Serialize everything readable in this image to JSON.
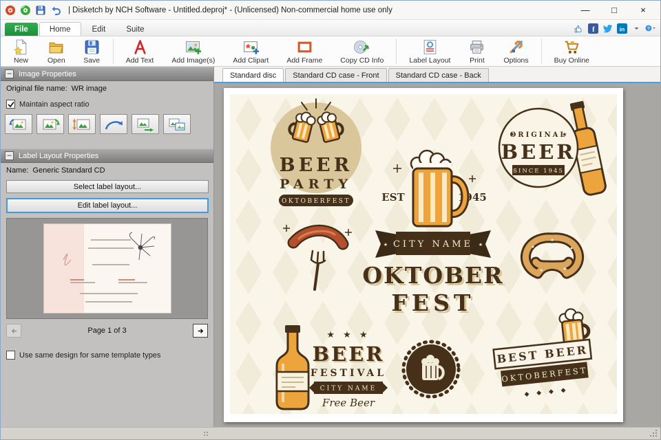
{
  "colors": {
    "accent_blue": "#45a0e6",
    "file_tab_green": "#1d8f3c",
    "poster_brown": "#463019",
    "poster_amber": "#eda43c",
    "poster_cream": "#f9f5e9"
  },
  "titlebar": {
    "title": "| Disketch by NCH Software - Untitled.deproj* - (Unlicensed) Non-commercial home use only",
    "minimize": "—",
    "maximize": "□",
    "close": "×"
  },
  "menubar": {
    "tabs": [
      {
        "label": "File"
      },
      {
        "label": "Home"
      },
      {
        "label": "Edit"
      },
      {
        "label": "Suite"
      }
    ],
    "help_label": "?",
    "social": {
      "facebook": "f",
      "linkedin": "in"
    }
  },
  "toolbar": {
    "buttons": [
      {
        "label": "New"
      },
      {
        "label": "Open"
      },
      {
        "label": "Save"
      },
      {
        "label": "Add Text"
      },
      {
        "label": "Add Image(s)"
      },
      {
        "label": "Add Clipart"
      },
      {
        "label": "Add Frame"
      },
      {
        "label": "Copy CD Info"
      },
      {
        "label": "Label Layout"
      },
      {
        "label": "Print"
      },
      {
        "label": "Options"
      },
      {
        "label": "Buy Online"
      }
    ]
  },
  "sidebar": {
    "image_properties": {
      "title": "Image Properties",
      "collapse": "–",
      "file_label": "Original file name:",
      "file_value": "WR image",
      "aspect_label": "Maintain aspect ratio"
    },
    "layout_properties": {
      "title": "Label Layout Properties",
      "collapse": "–",
      "name_label": "Name:",
      "name_value": "Generic Standard CD",
      "select_button": "Select label layout...",
      "edit_button": "Edit label layout...",
      "page_label": "Page 1 of 3",
      "same_design_label": "Use same design for same template types"
    }
  },
  "doc_tabs": [
    {
      "label": "Standard disc"
    },
    {
      "label": "Standard CD case - Front"
    },
    {
      "label": "Standard CD case - Back"
    }
  ],
  "poster": {
    "beer_party": {
      "beer": "BEER",
      "party": "PARTY",
      "badge": "OKTOBERFEST"
    },
    "original_beer": {
      "star": "★",
      "original": "ORIGINAL",
      "beer": "BEER",
      "since": "SINCE 1945"
    },
    "est": "EST",
    "year": "1945",
    "city_ribbon": "CITY NAME",
    "title1": "OKTOBER",
    "title2": "FEST",
    "festival": {
      "stars": "★ ★ ★",
      "beer": "BEER",
      "festival": "FESTIVAL",
      "city": "CITY NAME",
      "free": "Free Beer"
    },
    "best": {
      "best_beer": "BEST BEER",
      "oktoberfest": "OKTOBERFEST",
      "diamonds": "◆ ◆ ◆ ◆"
    }
  }
}
